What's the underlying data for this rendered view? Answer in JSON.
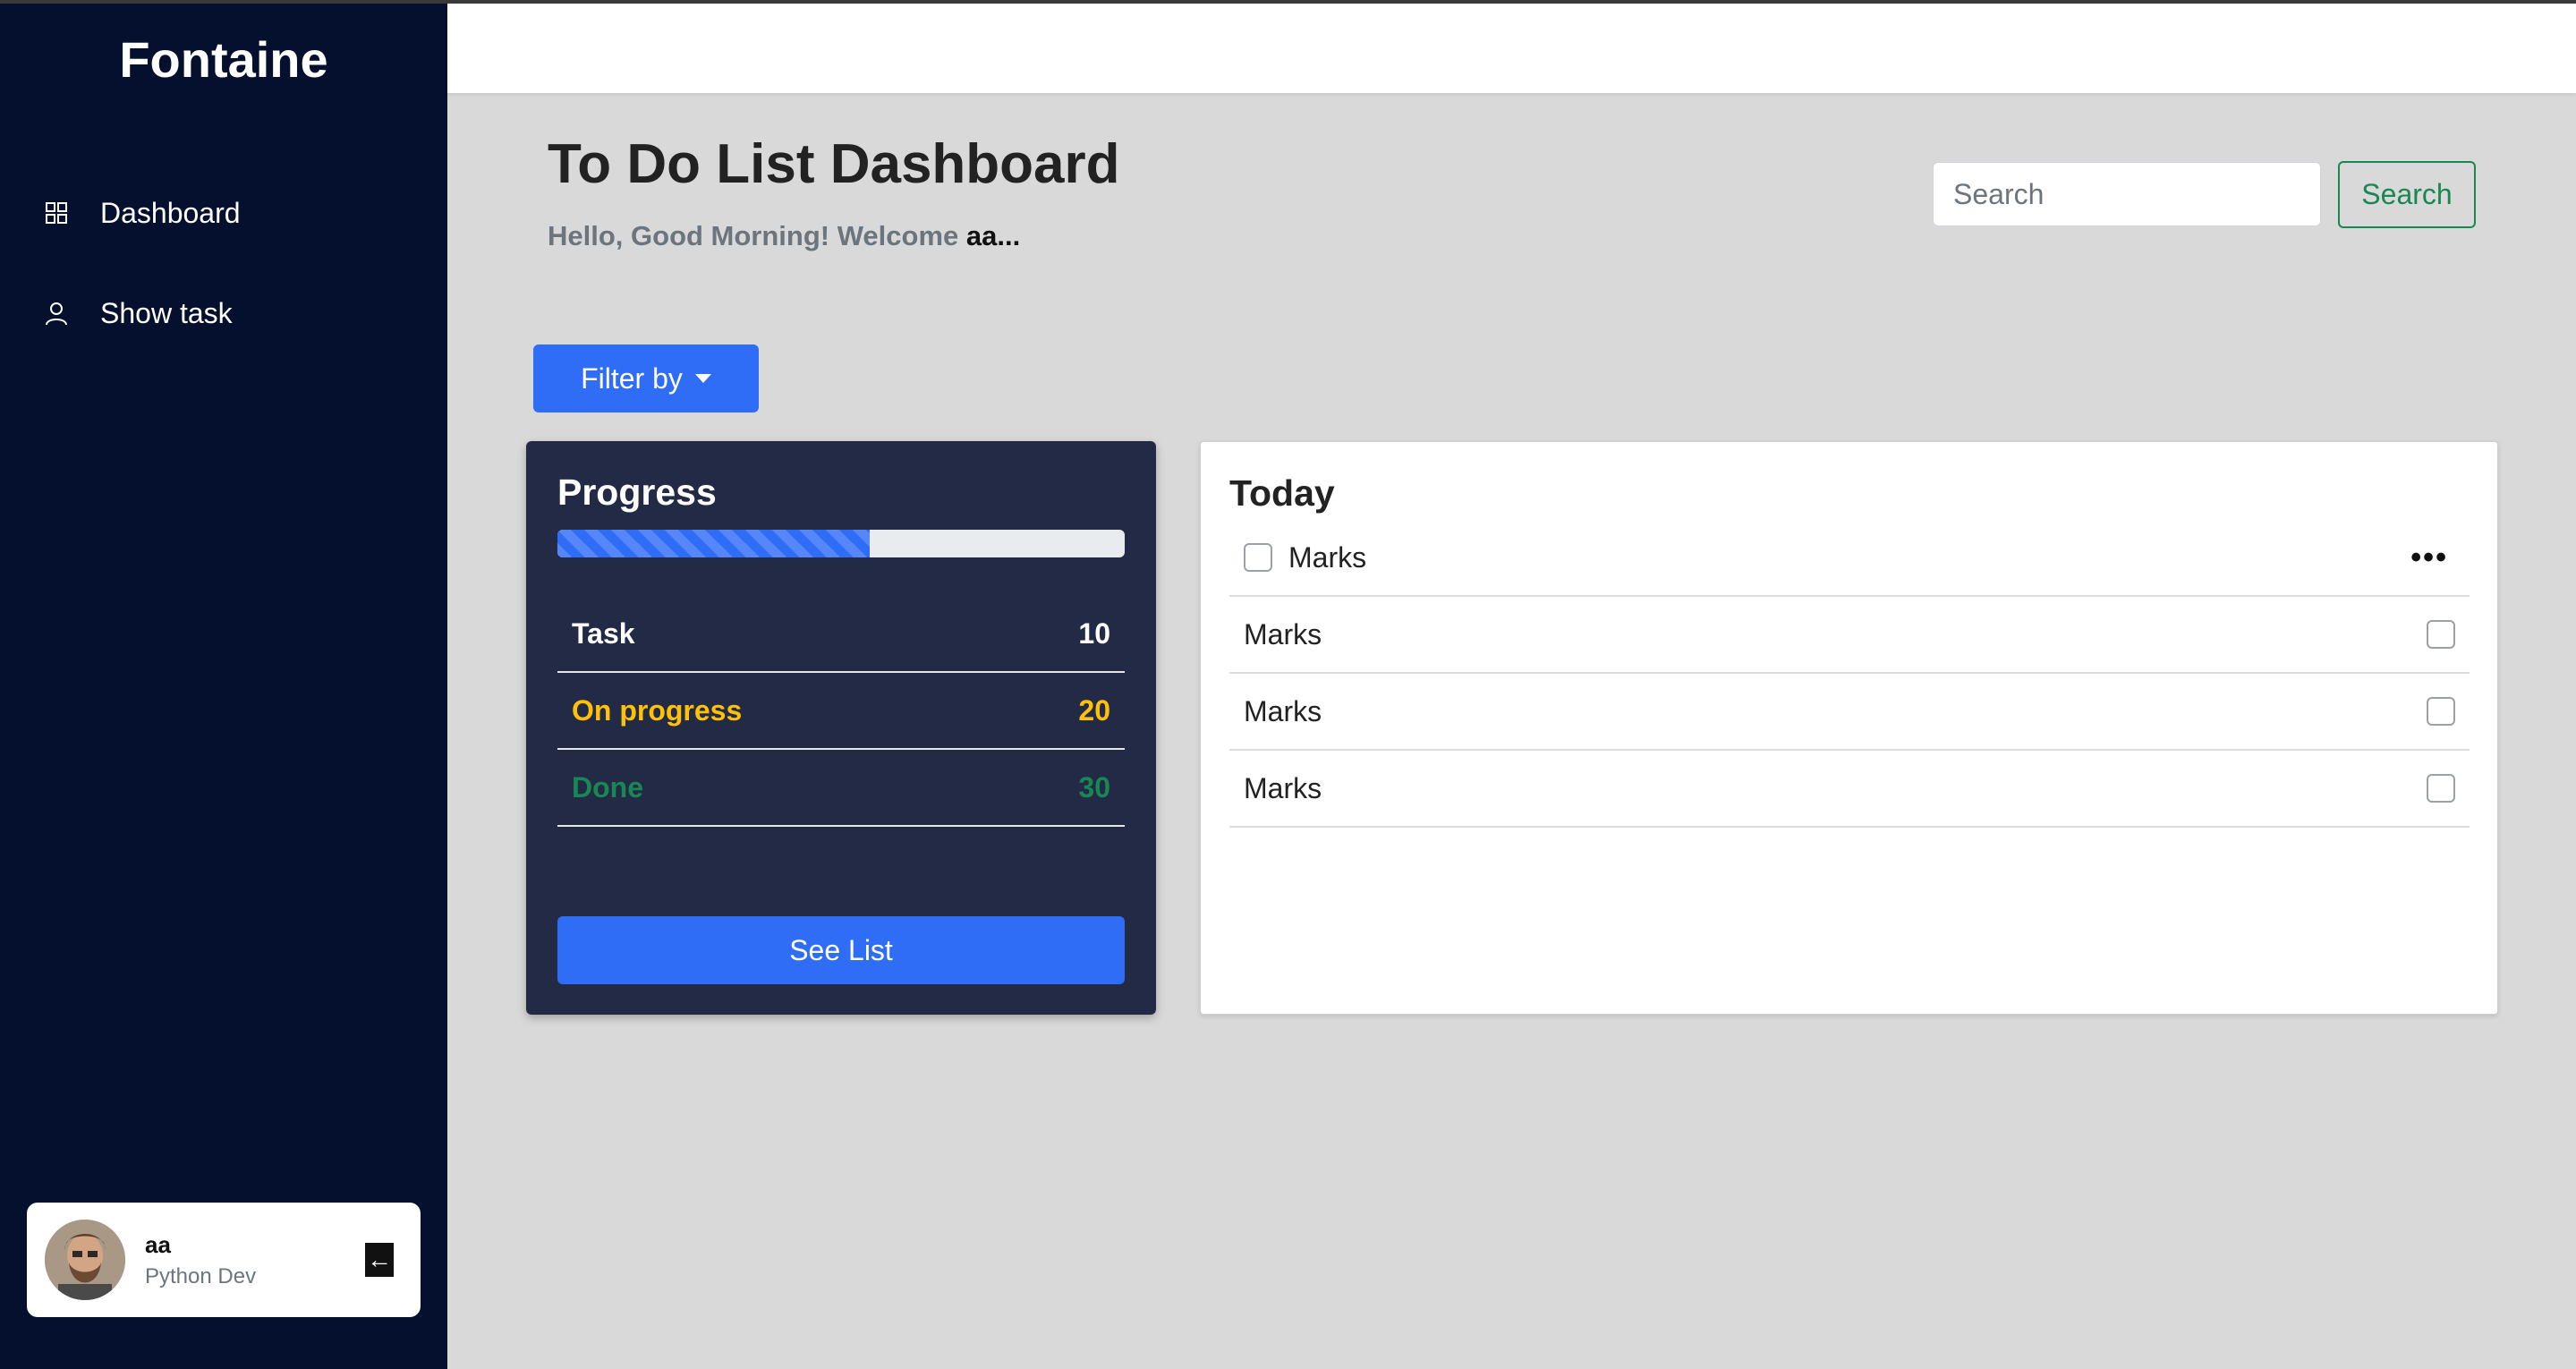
{
  "sidebar": {
    "brand": "Fontaine",
    "items": [
      {
        "label": "Dashboard",
        "icon": "grid-icon"
      },
      {
        "label": "Show task",
        "icon": "person-icon"
      }
    ],
    "user": {
      "name": "aa",
      "role": "Python Dev"
    }
  },
  "header": {
    "title": "To Do List Dashboard",
    "greeting_prefix": "Hello, Good Morning! Welcome ",
    "greeting_user": "aa..."
  },
  "search": {
    "placeholder": "Search",
    "button_label": "Search"
  },
  "filter": {
    "label": "Filter by"
  },
  "progress_card": {
    "title": "Progress",
    "progress_fraction": 0.55,
    "stats": [
      {
        "label": "Task",
        "value": "10",
        "color": "#ffffff"
      },
      {
        "label": "On progress",
        "value": "20",
        "color": "#ffc107"
      },
      {
        "label": "Done",
        "value": "30",
        "color": "#198754"
      }
    ],
    "button_label": "See List"
  },
  "today_card": {
    "title": "Today",
    "tasks": [
      {
        "label": "Marks"
      },
      {
        "label": "Marks"
      },
      {
        "label": "Marks"
      },
      {
        "label": "Marks"
      }
    ]
  },
  "colors": {
    "sidebar_bg": "#050f2e",
    "accent": "#2f6df6",
    "card_dark": "#222a45"
  }
}
